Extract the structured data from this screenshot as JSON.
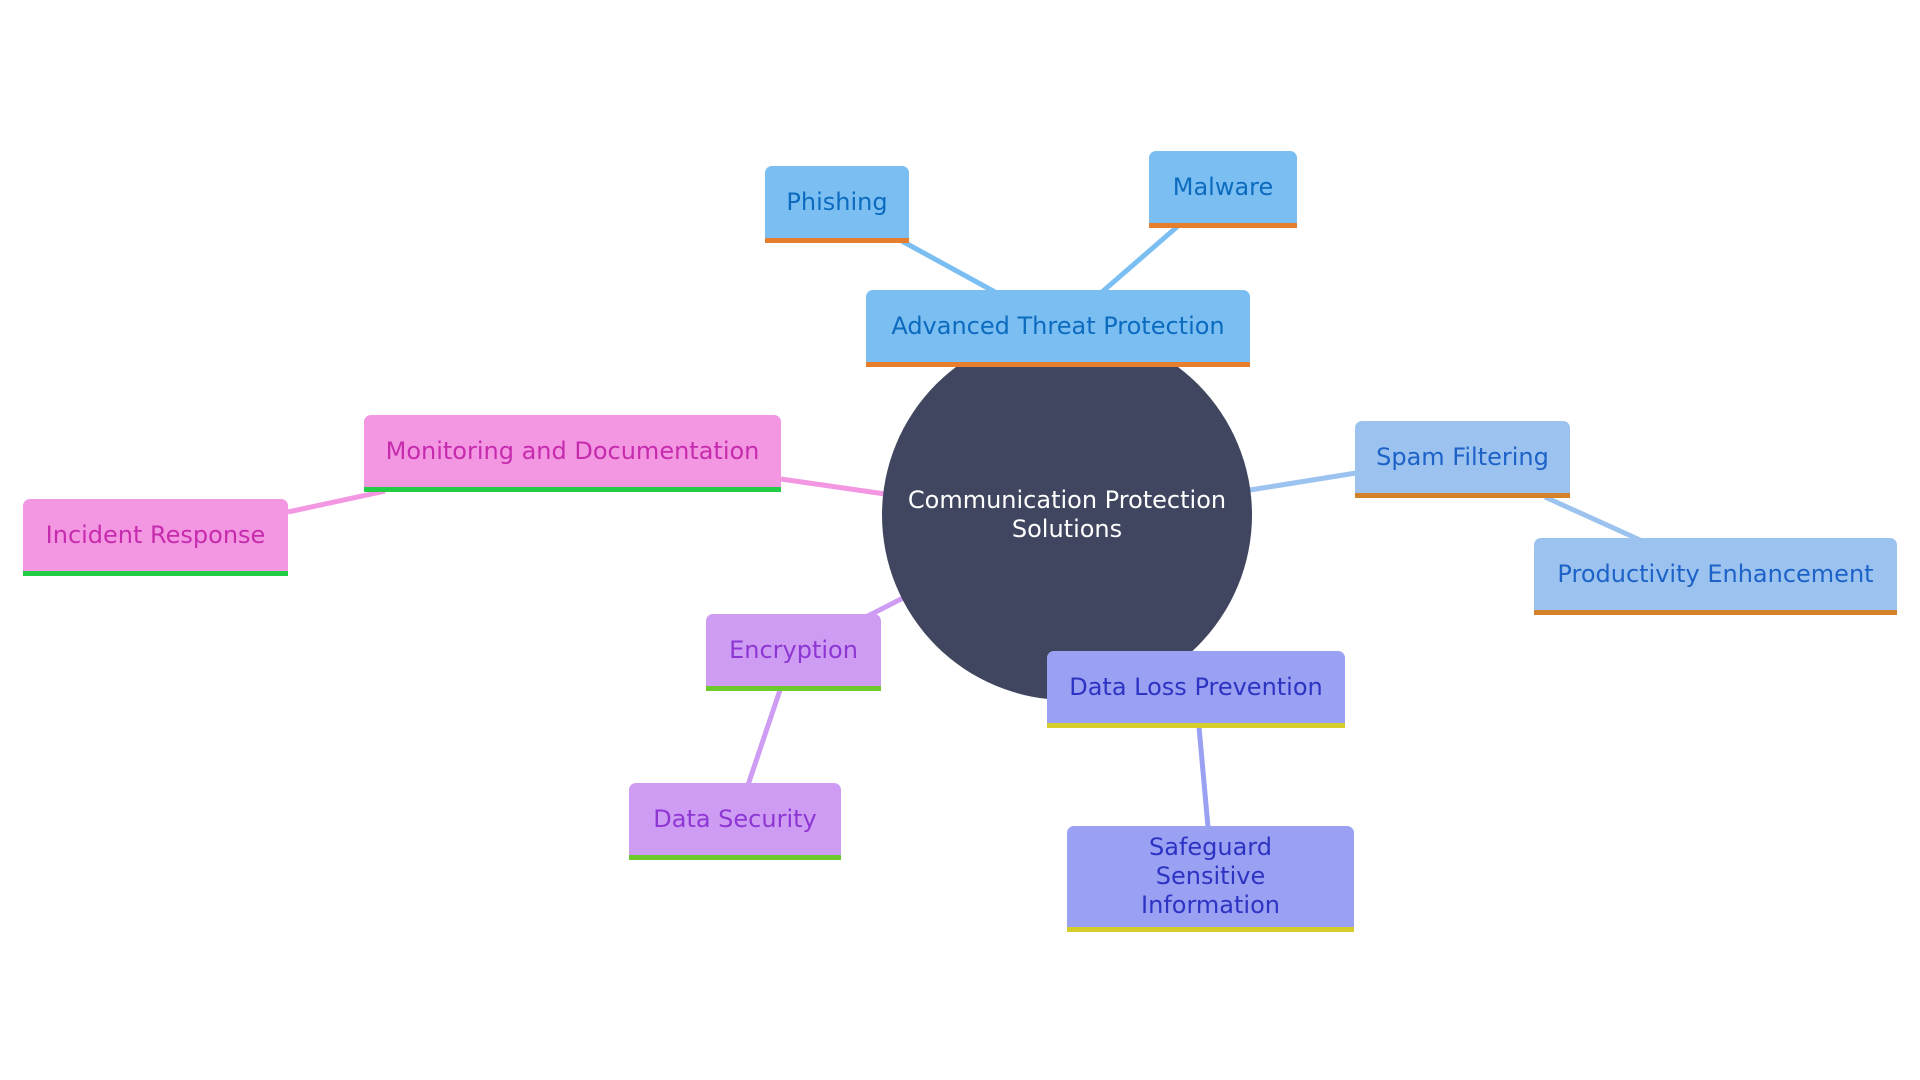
{
  "diagram": {
    "type": "mindmap",
    "root": "Communication Protection Solutions",
    "branches": [
      {
        "label": "Advanced Threat Protection",
        "children": [
          "Phishing",
          "Malware"
        ],
        "fill": "#7BBFF2",
        "text": "#0C6BBF",
        "accent": "#E67E2E"
      },
      {
        "label": "Spam Filtering",
        "children": [
          "Productivity Enhancement"
        ],
        "fill": "#9CC3F0",
        "text": "#1C62C7",
        "accent": "#D4822A"
      },
      {
        "label": "Data Loss Prevention",
        "children": [
          "Safeguard Sensitive Information"
        ],
        "fill": "#9AA1F2",
        "text": "#2D33C2",
        "accent": "#D6CC2A"
      },
      {
        "label": "Encryption",
        "children": [
          "Data Security"
        ],
        "fill": "#CE9DF3",
        "text": "#8E36D4",
        "accent": "#6CCB2A"
      },
      {
        "label": "Monitoring and Documentation",
        "children": [
          "Incident Response"
        ],
        "fill": "#F397E3",
        "text": "#C62BAE",
        "accent": "#22CC44"
      }
    ]
  },
  "colors": {
    "root_fill": "#414660",
    "root_text": "#ffffff"
  }
}
